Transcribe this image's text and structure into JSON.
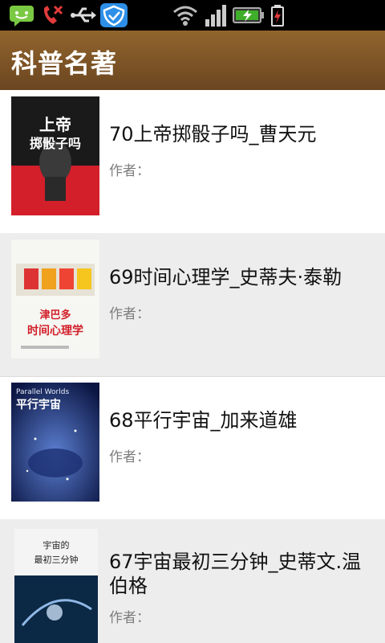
{
  "status_bar": {
    "icons": [
      "message-icon",
      "missed-call-icon",
      "usb-icon",
      "shield-app-icon",
      "wifi-icon",
      "signal-icon",
      "battery-icon",
      "charging-warning-icon"
    ]
  },
  "action_bar": {
    "title": "科普名著"
  },
  "books": [
    {
      "title": "70上帝掷骰子吗_曹天元",
      "author_label": "作者：",
      "cover_text": "上帝\n掷骰子吗"
    },
    {
      "title": "69时间心理学_史蒂夫·泰勒",
      "author_label": "作者：",
      "cover_text": "津巴多\n时间心理学"
    },
    {
      "title": "68平行宇宙_加来道雄",
      "author_label": "作者：",
      "cover_text": "Parallel Worlds\n平行宇宙"
    },
    {
      "title": "67宇宙最初三分钟_史蒂文.温伯格",
      "author_label": "作者：",
      "cover_text": "宇宙的\n最初三分钟"
    }
  ]
}
